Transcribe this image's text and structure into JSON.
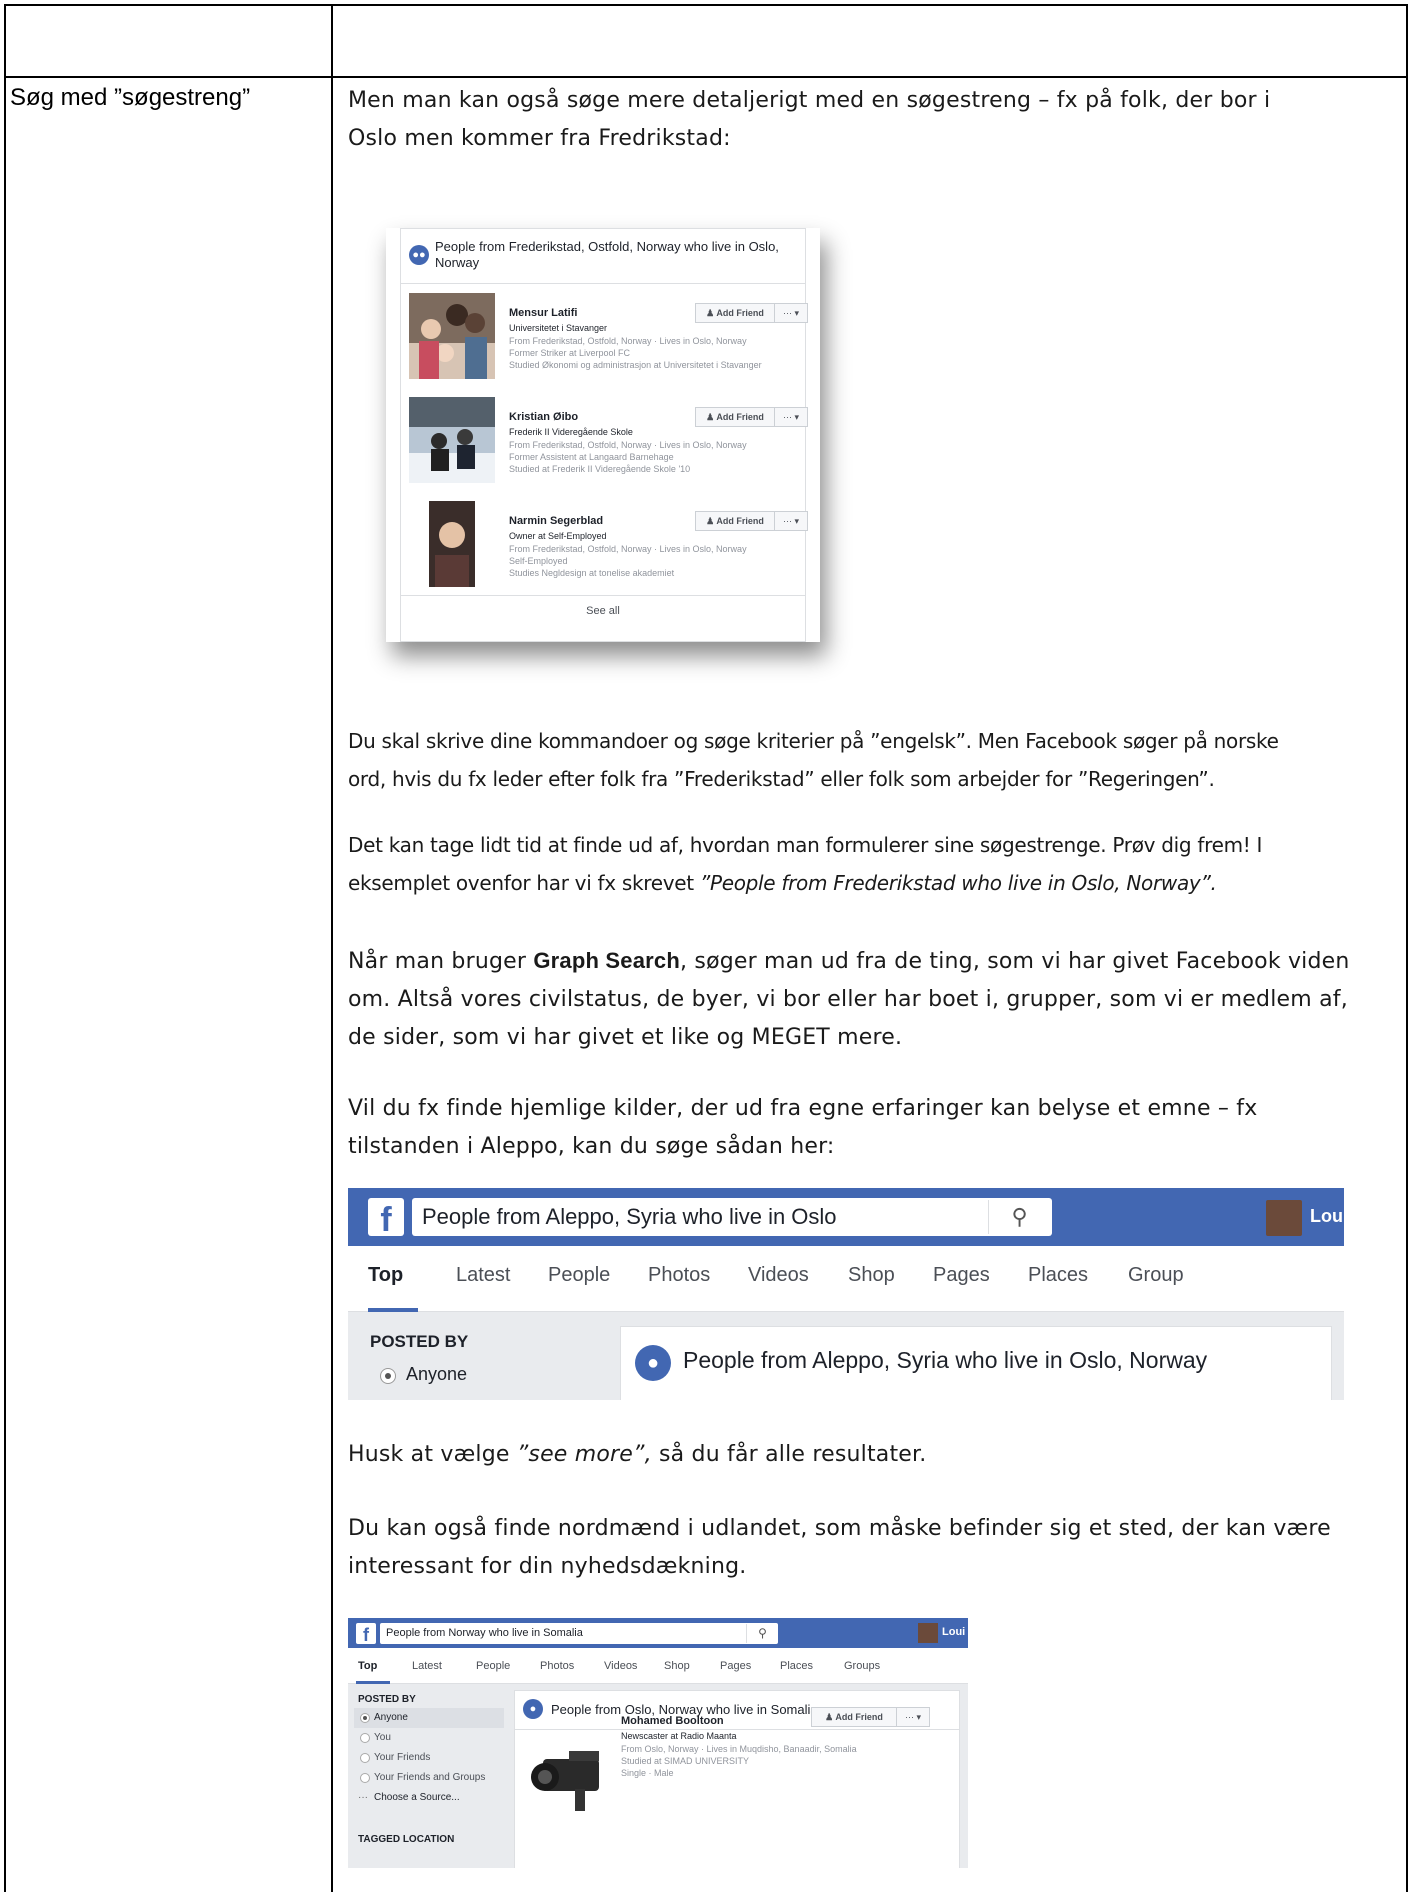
{
  "table": {
    "label": "Søg med ”søgestreng”"
  },
  "intro": [
    "Men man kan også søge mere detaljerigt med en søgestreng – fx på folk, der bor i",
    "Oslo men kommer fra Fredrikstad:"
  ],
  "shot1": {
    "heading": "People from Frederikstad, Ostfold, Norway who live in Oslo, Norway",
    "add_friend": "Add Friend",
    "more": "··· ▾",
    "people": [
      {
        "name": "Mensur Latifi",
        "line1": "Universitetet i Stavanger",
        "line2": "From Frederikstad, Ostfold, Norway · Lives in Oslo, Norway",
        "line3": "Former Striker at Liverpool FC",
        "line4": "Studied Økonomi og administrasjon at Universitetet i Stavanger"
      },
      {
        "name": "Kristian Øibo",
        "line1": "Frederik II Videregående Skole",
        "line2": "From Frederikstad, Ostfold, Norway · Lives in Oslo, Norway",
        "line3": "Former Assistent at Langaard Barnehage",
        "line4": "Studied at Frederik II Videregående Skole '10"
      },
      {
        "name": "Narmin Segerblad",
        "line1": "Owner at Self-Employed",
        "line2": "From Frederikstad, Ostfold, Norway · Lives in Oslo, Norway",
        "line3": "Self-Employed",
        "line4": "Studies Negldesign at tonelise akademiet"
      }
    ],
    "see_all": "See all"
  },
  "para1": [
    "Du skal skrive dine kommandoer og søge kriterier på ”engelsk”. Men Facebook søger på norske",
    "ord, hvis du fx leder efter folk fra ”Frederikstad” eller folk som arbejder for ”Regeringen”."
  ],
  "para2": {
    "line1": "Det kan tage lidt tid at finde ud af, hvordan man formulerer sine søgestrenge.  Prøv dig frem! I",
    "line2_start": "eksemplet ovenfor har vi fx skrevet ",
    "line2_em": "”People from Frederikstad who live in Oslo, Norway”."
  },
  "para3": {
    "start": "Når man bruger ",
    "bold": "Graph Search",
    "line1_rest": ", søger man ud fra de ting, som vi har givet Facebook viden",
    "line2": "om. Altså vores civilstatus, de byer, vi bor eller har boet i, grupper, som vi er medlem af,",
    "line3": "de sider, som vi har givet et like og MEGET mere."
  },
  "para4": [
    "Vil du fx finde hjemlige kilder, der ud fra egne erfaringer kan belyse et emne – fx",
    "tilstanden i Aleppo, kan du søge sådan her:"
  ],
  "shot2": {
    "logo": "f",
    "search": "People from Aleppo, Syria who live in Oslo",
    "search_icon": "⚲",
    "user": "Lou",
    "tabs": [
      "Top",
      "Latest",
      "People",
      "Photos",
      "Videos",
      "Shop",
      "Pages",
      "Places",
      "Group"
    ],
    "posted_by": "POSTED BY",
    "anyone": "Anyone",
    "result_title": "People from Aleppo, Syria who live in Oslo, Norway"
  },
  "para5": {
    "start": "Husk at vælge ",
    "em": "”see more”,",
    "rest": " så du får alle resultater."
  },
  "para6": [
    "Du kan også finde nordmænd i udlandet, som måske befinder sig et sted, der kan være",
    "interessant for din nyhedsdækning."
  ],
  "shot3": {
    "logo": "f",
    "search": "People from Norway who live in Somalia",
    "search_icon": "⚲",
    "user": "Loui",
    "tabs": [
      "Top",
      "Latest",
      "People",
      "Photos",
      "Videos",
      "Shop",
      "Pages",
      "Places",
      "Groups"
    ],
    "posted_by": "POSTED BY",
    "options": [
      "Anyone",
      "You",
      "Your Friends",
      "Your Friends and Groups"
    ],
    "choose": "Choose a Source...",
    "tagged": "TAGGED LOCATION",
    "result_title": "People from Oslo, Norway who live in Somalia",
    "person": {
      "name": "Mohamed Booltoon",
      "line1": "Newscaster at Radio Maanta",
      "line2": "From Oslo, Norway · Lives in Muqdisho, Banaadir, Somalia",
      "line3": "Studied at SIMAD UNIVERSITY",
      "line4": "Single · Male"
    },
    "add_friend": "Add Friend",
    "more": "··· ▾"
  }
}
